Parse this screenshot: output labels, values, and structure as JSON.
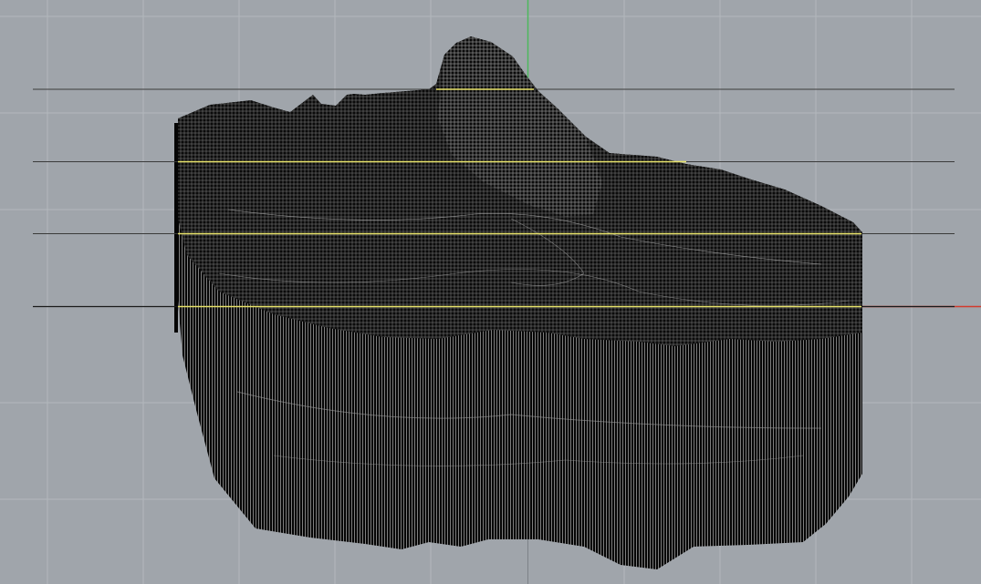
{
  "viewport": {
    "background": "#a0a5ab",
    "grid_color": "#b3b8bd",
    "axis_x_color": "#d23a2c",
    "axis_y_color": "#4db85c",
    "mesh_color": "#050505",
    "mesh_wire_color": "#c8c8c8",
    "section_line_color": "#3a3a3a",
    "section_highlight_color": "#e8e36a",
    "view": "front"
  },
  "scene": {
    "object": "mesh-relief",
    "section_count": 4
  }
}
